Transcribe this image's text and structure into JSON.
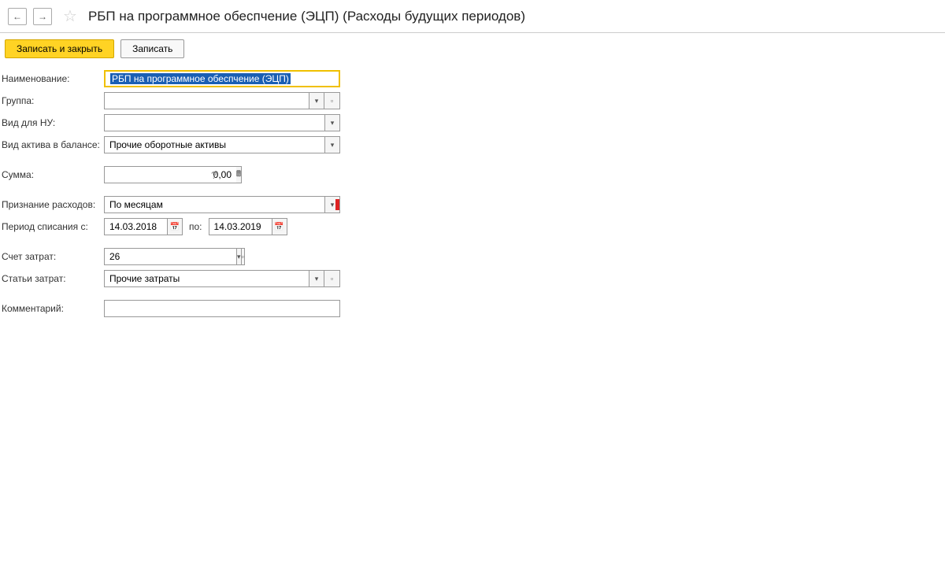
{
  "header": {
    "title": "РБП на программное обеспчение (ЭЦП) (Расходы будущих периодов)"
  },
  "toolbar": {
    "save_close": "Записать и закрыть",
    "save": "Записать"
  },
  "labels": {
    "name": "Наименование:",
    "group": "Группа:",
    "kind_nu": "Вид для НУ:",
    "asset_kind": "Вид актива в балансе:",
    "sum": "Сумма:",
    "recognition": "Признание расходов:",
    "period": "Период списания с:",
    "po": "по:",
    "account": "Счет затрат:",
    "cost_item": "Статьи затрат:",
    "comment": "Комментарий:"
  },
  "values": {
    "name": "РБП на программное обеспчение (ЭЦП)",
    "group": "",
    "kind_nu": "",
    "asset_kind": "Прочие оборотные активы",
    "sum": "0,00",
    "recognition": "По месяцам",
    "date_from": "14.03.2018",
    "date_to": "14.03.2019",
    "account": "26",
    "cost_item": "Прочие затраты",
    "comment": ""
  },
  "icons": {
    "back": "←",
    "forward": "→",
    "star": "☆",
    "dropdown": "▾",
    "open": "▫",
    "calendar": "📅",
    "calc": "🖩",
    "help": "?"
  }
}
